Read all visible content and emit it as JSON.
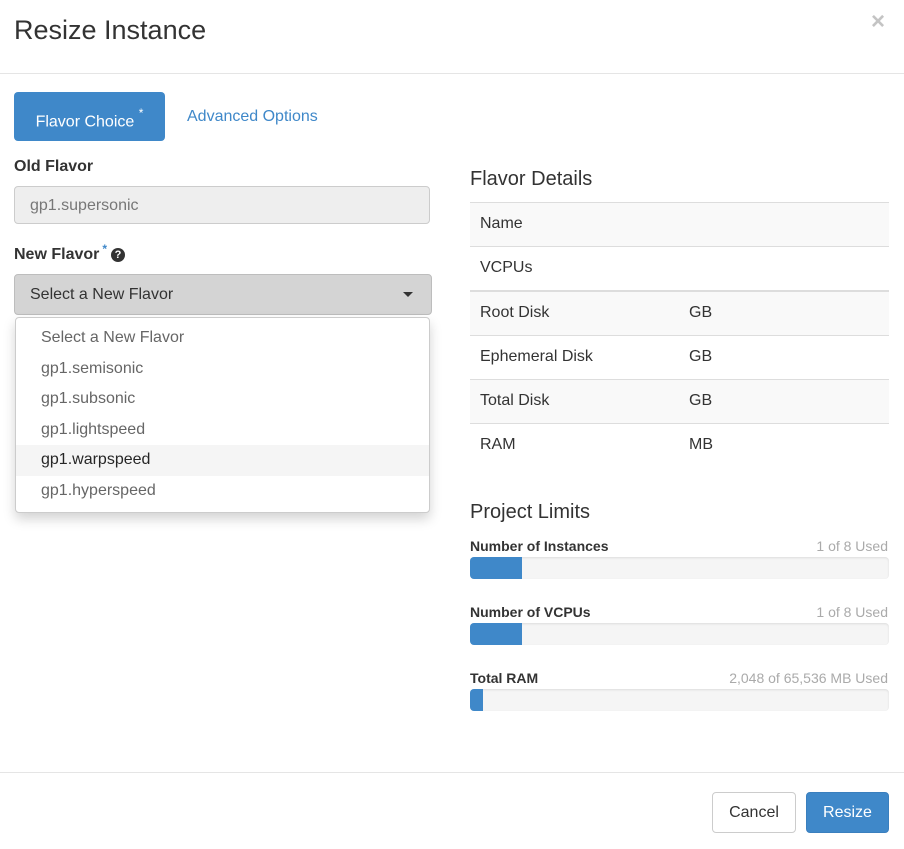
{
  "modal": {
    "title": "Resize Instance",
    "close_icon": "×"
  },
  "tabs": [
    {
      "label": "Flavor Choice",
      "required_marker": "*",
      "active": true
    },
    {
      "label": "Advanced Options",
      "active": false
    }
  ],
  "form": {
    "old_flavor": {
      "label": "Old Flavor",
      "value": "gp1.supersonic"
    },
    "new_flavor": {
      "label": "New Flavor",
      "required_marker": "*",
      "help_icon": "?",
      "selected": "Select a New Flavor",
      "options": [
        "Select a New Flavor",
        "gp1.semisonic",
        "gp1.subsonic",
        "gp1.lightspeed",
        "gp1.warpspeed",
        "gp1.hyperspeed"
      ],
      "highlighted_option": "gp1.warpspeed"
    }
  },
  "flavor_details": {
    "title": "Flavor Details",
    "rows": [
      {
        "key": "Name",
        "value": ""
      },
      {
        "key": "VCPUs",
        "value": ""
      },
      {
        "key": "Root Disk",
        "value": "GB"
      },
      {
        "key": "Ephemeral Disk",
        "value": "GB"
      },
      {
        "key": "Total Disk",
        "value": "GB"
      },
      {
        "key": "RAM",
        "value": "MB"
      }
    ]
  },
  "project_limits": {
    "title": "Project Limits",
    "items": [
      {
        "label": "Number of Instances",
        "used_text": "1 of 8 Used",
        "fraction": 0.125
      },
      {
        "label": "Number of VCPUs",
        "used_text": "1 of 8 Used",
        "fraction": 0.125
      },
      {
        "label": "Total RAM",
        "used_text": "2,048 of 65,536 MB Used",
        "fraction": 0.03125
      }
    ]
  },
  "footer": {
    "cancel_label": "Cancel",
    "submit_label": "Resize"
  },
  "colors": {
    "primary": "#3f88c9",
    "close_icon": "#c4c4c4"
  }
}
